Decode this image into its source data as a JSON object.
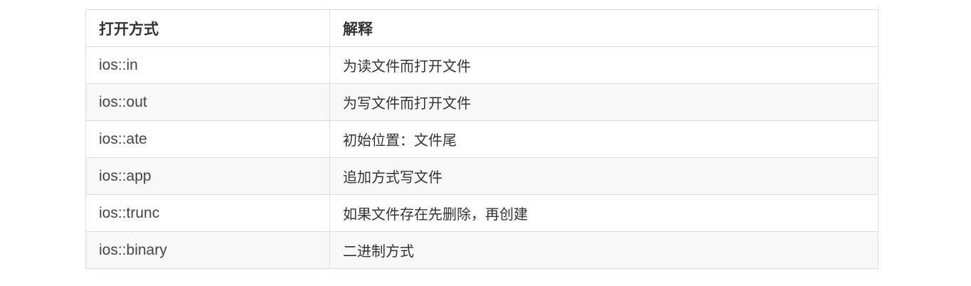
{
  "table": {
    "headers": [
      "打开方式",
      "解释"
    ],
    "rows": [
      [
        "ios::in",
        "为读文件而打开文件"
      ],
      [
        "ios::out",
        "为写文件而打开文件"
      ],
      [
        "ios::ate",
        "初始位置：文件尾"
      ],
      [
        "ios::app",
        "追加方式写文件"
      ],
      [
        "ios::trunc",
        "如果文件存在先删除，再创建"
      ],
      [
        "ios::binary",
        "二进制方式"
      ]
    ]
  },
  "colors": {
    "border": "#dddddd",
    "striped_row": "#f8f8f8",
    "text": "#333333"
  }
}
